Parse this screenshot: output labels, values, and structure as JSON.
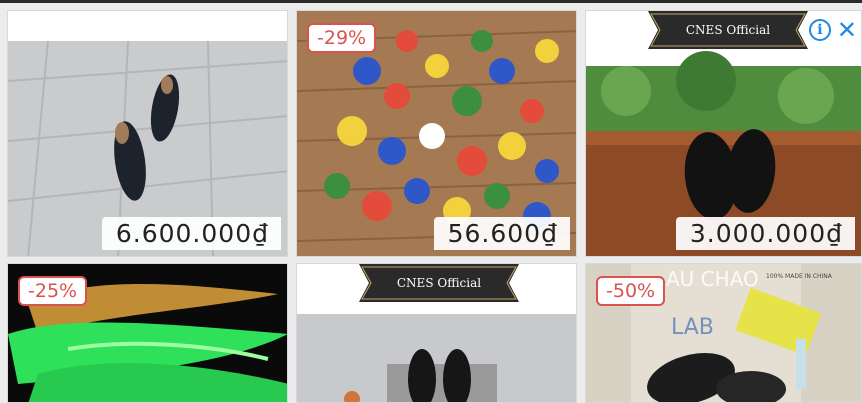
{
  "ad": {
    "info_icon": "i",
    "close_icon": "✕"
  },
  "products": [
    {
      "price": "6.600.000₫",
      "discount": "",
      "image": "black leather oxford shoes on tiled floor"
    },
    {
      "price": "56.600₫",
      "discount": "-29%",
      "image": "assorted cartoon shoe charms"
    },
    {
      "price": "3.000.000₫",
      "discount": "",
      "image": "black leather dress shoes on wooden rail",
      "brand": "CNES Official"
    },
    {
      "price": "",
      "discount": "-25%",
      "image": "glow-in-the-dark green shoelaces"
    },
    {
      "price": "",
      "discount": "",
      "image": "black loafers",
      "brand": "CNES Official"
    },
    {
      "price": "",
      "discount": "-50%",
      "image": "black slide sandals with stickers",
      "image_text": "100% MADE IN CHINA"
    }
  ],
  "colors": {
    "discount": "#d9534f",
    "accent": "#1e88e5",
    "price_text": "#222222"
  }
}
